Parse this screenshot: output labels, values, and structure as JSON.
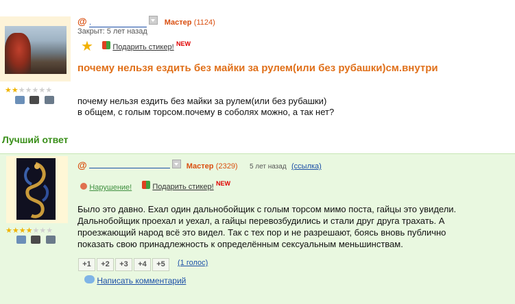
{
  "question": {
    "user": {
      "at": "@",
      "name": ".",
      "rank": "Мастер",
      "points": "(1124)"
    },
    "closed": "Закрыт: 5 лет назад",
    "gift_link": "Подарить стикер!",
    "new_badge": "NEW",
    "title": "почему нельзя ездить без майки за рулем(или без рубашки)см.внутри",
    "body_line1": "почему нельзя ездить без майки за рулем(или без рубашки)",
    "body_line2": "в общем, с голым торсом.почему в соболях можно, а так нет?",
    "stars_filled": 2,
    "stars_total": 7
  },
  "best_answer_heading": "Лучший ответ",
  "answer": {
    "user": {
      "at": "@",
      "name": "",
      "rank": "Мастер",
      "points": "(2329)"
    },
    "time": "5 лет назад",
    "link_label": "(ссылка)",
    "report_label": "Нарушение!",
    "gift_link": "Подарить стикер!",
    "new_badge": "NEW",
    "body_lines": [
      "Было это давно. Ехал один дальнобойщик с голым торсом мимо поста, гайцы это увидели.",
      "Дальнобойщик проехал и уехал, а гайцы перевозбудились и стали друг друга трахать. А",
      "проезжающий народ всё это видел. Так с тех пор и не разрешают, боясь вновь публично",
      "показать свою принадлежность к определённым сексуальным меньшинствам."
    ],
    "votes": [
      "+1",
      "+2",
      "+3",
      "+4",
      "+5"
    ],
    "votes_count": "(1 голос)",
    "comment_link": "Написать комментарий",
    "stars_filled": 4,
    "stars_total": 7
  }
}
